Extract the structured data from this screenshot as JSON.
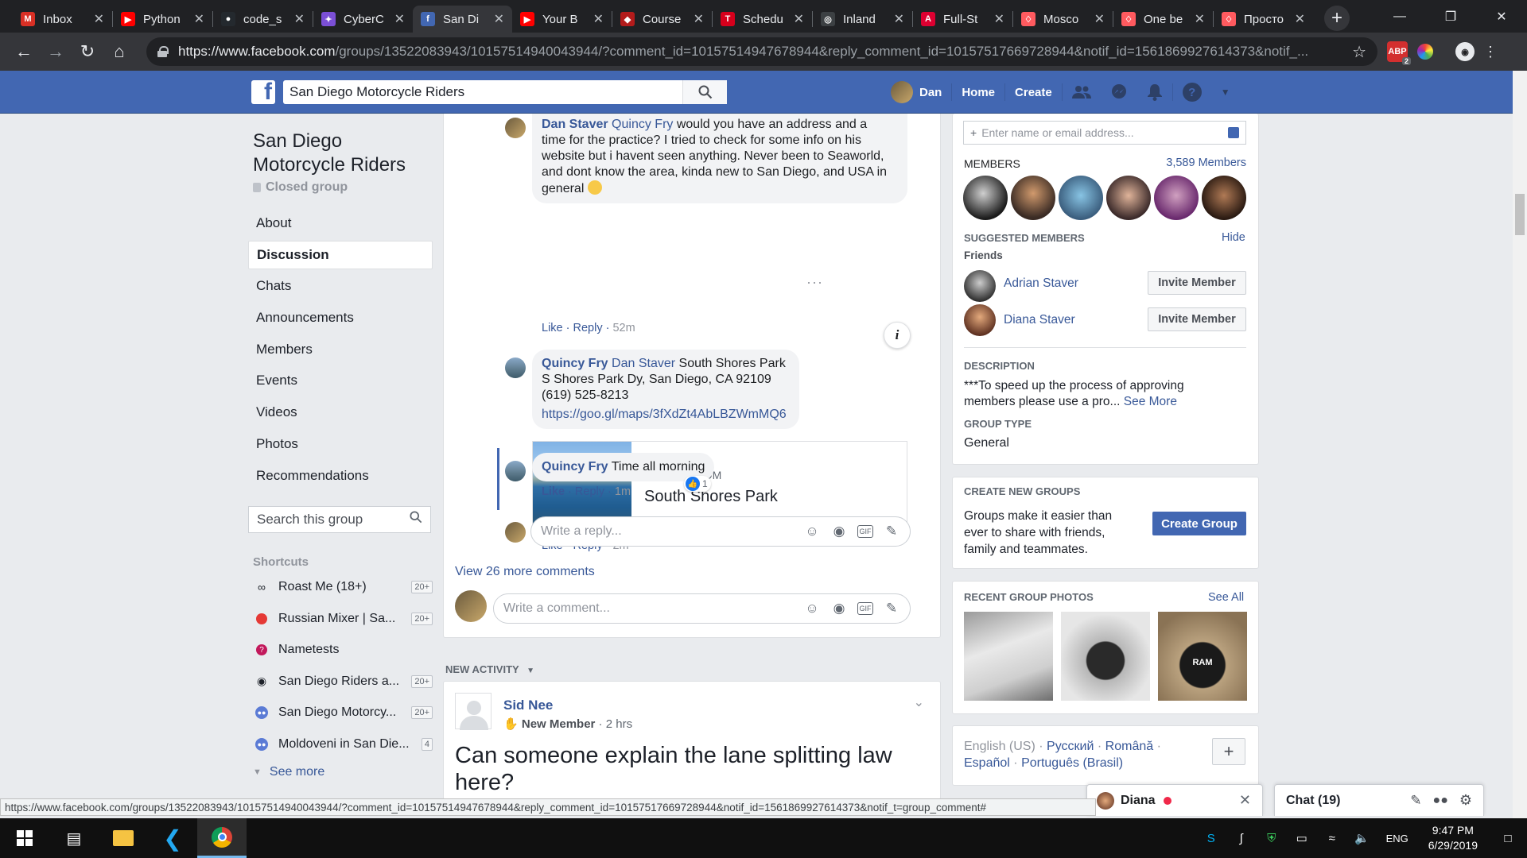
{
  "browser": {
    "tabs": [
      {
        "title": "Inbox",
        "icon": "gmail-icon",
        "color": "#d93025",
        "glyph": "M"
      },
      {
        "title": "Python",
        "icon": "youtube-icon",
        "color": "#ff0000",
        "glyph": "▶"
      },
      {
        "title": "code_s",
        "icon": "github-icon",
        "color": "#24292e",
        "glyph": "●"
      },
      {
        "title": "CyberC",
        "icon": "cyber-icon",
        "color": "#7b4fd6",
        "glyph": "✦"
      },
      {
        "title": "San Di",
        "icon": "facebook-icon",
        "color": "#4267b2",
        "glyph": "f",
        "active": true
      },
      {
        "title": "Your B",
        "icon": "youtube-icon",
        "color": "#ff0000",
        "glyph": "▶"
      },
      {
        "title": "Course",
        "icon": "course-icon",
        "color": "#b31b1b",
        "glyph": "◆"
      },
      {
        "title": "Schedu",
        "icon": "tc-icon",
        "color": "#d6001c",
        "glyph": "T"
      },
      {
        "title": "Inland",
        "icon": "globe-icon",
        "color": "#3c4043",
        "glyph": "◎"
      },
      {
        "title": "Full-St",
        "icon": "angular-icon",
        "color": "#dd0031",
        "glyph": "A"
      },
      {
        "title": "Mosco",
        "icon": "airbnb-icon",
        "color": "#ff5a5f",
        "glyph": "♢"
      },
      {
        "title": "One be",
        "icon": "airbnb-icon",
        "color": "#ff5a5f",
        "glyph": "♢"
      },
      {
        "title": "Просто",
        "icon": "airbnb-icon",
        "color": "#ff5a5f",
        "glyph": "♢"
      }
    ],
    "url_host": "https://www.facebook.com",
    "url_path": "/groups/13522083943/10157514940043944/?comment_id=10157514947678944&reply_comment_id=10157517669728944&notif_id=1561869927614373&notif_...",
    "status_url": "https://www.facebook.com/groups/13522083943/10157514940043944/?comment_id=10157514947678944&reply_comment_id=10157517669728944&notif_id=1561869927614373&notif_t=group_comment#",
    "abp_badge": "2"
  },
  "fb": {
    "search_value": "San Diego Motorcycle Riders",
    "user_name": "Dan",
    "nav_home": "Home",
    "nav_create": "Create"
  },
  "group": {
    "title_line1": "San Diego",
    "title_line2": "Motorcycle Riders",
    "privacy": "Closed group",
    "nav": [
      "About",
      "Discussion",
      "Chats",
      "Announcements",
      "Members",
      "Events",
      "Videos",
      "Photos",
      "Recommendations"
    ],
    "search_placeholder": "Search this group",
    "shortcuts_title": "Shortcuts",
    "shortcuts": [
      {
        "label": "Roast Me (18+)",
        "count": "20+",
        "icon": "glasses-icon"
      },
      {
        "label": "Russian Mixer | Sa...",
        "count": "20+",
        "icon": "tomato-icon"
      },
      {
        "label": "Nametests",
        "count": "",
        "icon": "nametests-icon"
      },
      {
        "label": "San Diego Riders a...",
        "count": "20+",
        "icon": "camera-icon"
      },
      {
        "label": "San Diego Motorcy...",
        "count": "20+",
        "icon": "group-icon"
      },
      {
        "label": "Moldoveni in San Die...",
        "count": "4",
        "icon": "group-icon"
      }
    ],
    "see_more": "See more"
  },
  "comments": {
    "c1": {
      "name": "Dan Staver",
      "tag": "Quincy Fry",
      "l1": " would you have an address and a",
      "l2": "time for the practice? I tried to check for some info on his",
      "l3": "website but i havent seen anything. Never been to Seaworld,",
      "l4": "and dont know the area, kinda new to San Diego, and USA in",
      "l5": "general",
      "like": "Like",
      "reply": "Reply",
      "time": "52m"
    },
    "c2": {
      "name": "Quincy Fry",
      "tag": "Dan Staver",
      "l1": " South Shores Park",
      "l2": "S Shores Park Dy, San Diego, CA 92109",
      "l3": "(619) 525-8213",
      "link": "https://goo.gl/maps/3fXdZt4AbLBZWmMQ6",
      "like": "Like",
      "reply": "Reply",
      "time": "2m"
    },
    "card": {
      "domain": "GOOGLE.COM",
      "title": "South Shores Park"
    },
    "c3": {
      "name": "Quincy Fry",
      "text": " Time all morning",
      "like": "Like",
      "reply": "Reply",
      "time": "1m",
      "reactions": "1"
    },
    "reply_placeholder": "Write a reply...",
    "view_more": "View 26 more comments",
    "comment_placeholder": "Write a comment..."
  },
  "activity": {
    "header": "NEW ACTIVITY",
    "author": "Sid Nee",
    "badge": "New Member",
    "time": "2 hrs",
    "text": "Can someone explain the lane splitting law here?"
  },
  "right": {
    "invite_placeholder": "Enter name or email address...",
    "members_label": "MEMBERS",
    "members_count": "3,589 Members",
    "suggested_label": "SUGGESTED MEMBERS",
    "hide": "Hide",
    "friends_label": "Friends",
    "suggested": [
      {
        "name": "Adrian Staver",
        "button": "Invite Member"
      },
      {
        "name": "Diana Staver",
        "button": "Invite Member"
      }
    ],
    "description_label": "DESCRIPTION",
    "description_l1": "***To speed up the process of approving",
    "description_l2": "members please use a pro...",
    "see_more": "See More",
    "type_label": "GROUP TYPE",
    "type_value": "General",
    "create_label": "CREATE NEW GROUPS",
    "create_l1": "Groups make it easier than",
    "create_l2": "ever to share with friends,",
    "create_l3": "family and teammates.",
    "create_button": "Create Group",
    "photos_label": "RECENT GROUP PHOTOS",
    "see_all": "See All",
    "photo_brand": "RAM",
    "languages_l1": [
      "English (US)",
      "Русский",
      "Română"
    ],
    "languages_l2": [
      "Español",
      "Português (Brasil)"
    ]
  },
  "chat": {
    "diana": "Diana",
    "chat_label": "Chat (19)"
  },
  "taskbar": {
    "lang": "ENG",
    "time": "9:47 PM",
    "date": "6/29/2019"
  }
}
